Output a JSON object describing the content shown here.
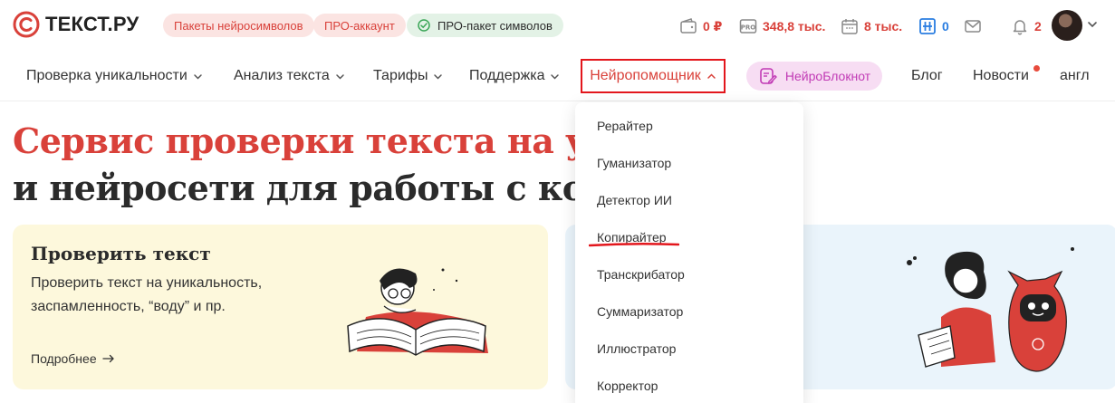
{
  "logo": {
    "text": "ТЕКСТ.РУ"
  },
  "chips": [
    {
      "label": "Пакеты нейросимволов"
    },
    {
      "label": "ПРО-аккаунт"
    },
    {
      "label": "ПРО-пакет символов"
    }
  ],
  "stats": {
    "wallet": "0 ₽",
    "pro": "348,8 тыс.",
    "calendar": "8 тыс.",
    "counter": "0",
    "notifications": "2"
  },
  "nav": {
    "items": [
      {
        "label": "Проверка уникальности"
      },
      {
        "label": "Анализ текста"
      },
      {
        "label": "Тарифы"
      },
      {
        "label": "Поддержка"
      }
    ],
    "active": "Нейропомощник",
    "neuro_notebook": "НейроБлокнот",
    "blog": "Блог",
    "news": "Новости",
    "lang": "англ"
  },
  "hero": {
    "line1": "Сервис проверки текста на уни",
    "line2": "и нейросети для работы с конт"
  },
  "card_check": {
    "title": "Проверить текст",
    "desc": "Проверить текст на уникальность, заспамленность, “воду” и пр.",
    "more": "Подробнее"
  },
  "dropdown": {
    "items": [
      {
        "label": "Рерайтер"
      },
      {
        "label": "Гуманизатор"
      },
      {
        "label": "Детектор ИИ"
      },
      {
        "label": "Копирайтер"
      },
      {
        "label": "Транскрибатор"
      },
      {
        "label": "Суммаризатор"
      },
      {
        "label": "Иллюстратор"
      },
      {
        "label": "Корректор"
      }
    ]
  },
  "colors": {
    "brand_red": "#d9413a",
    "accent_blue": "#2a7de1",
    "highlight_border": "#e3161c",
    "neuro_pink": "#c13ab5"
  }
}
